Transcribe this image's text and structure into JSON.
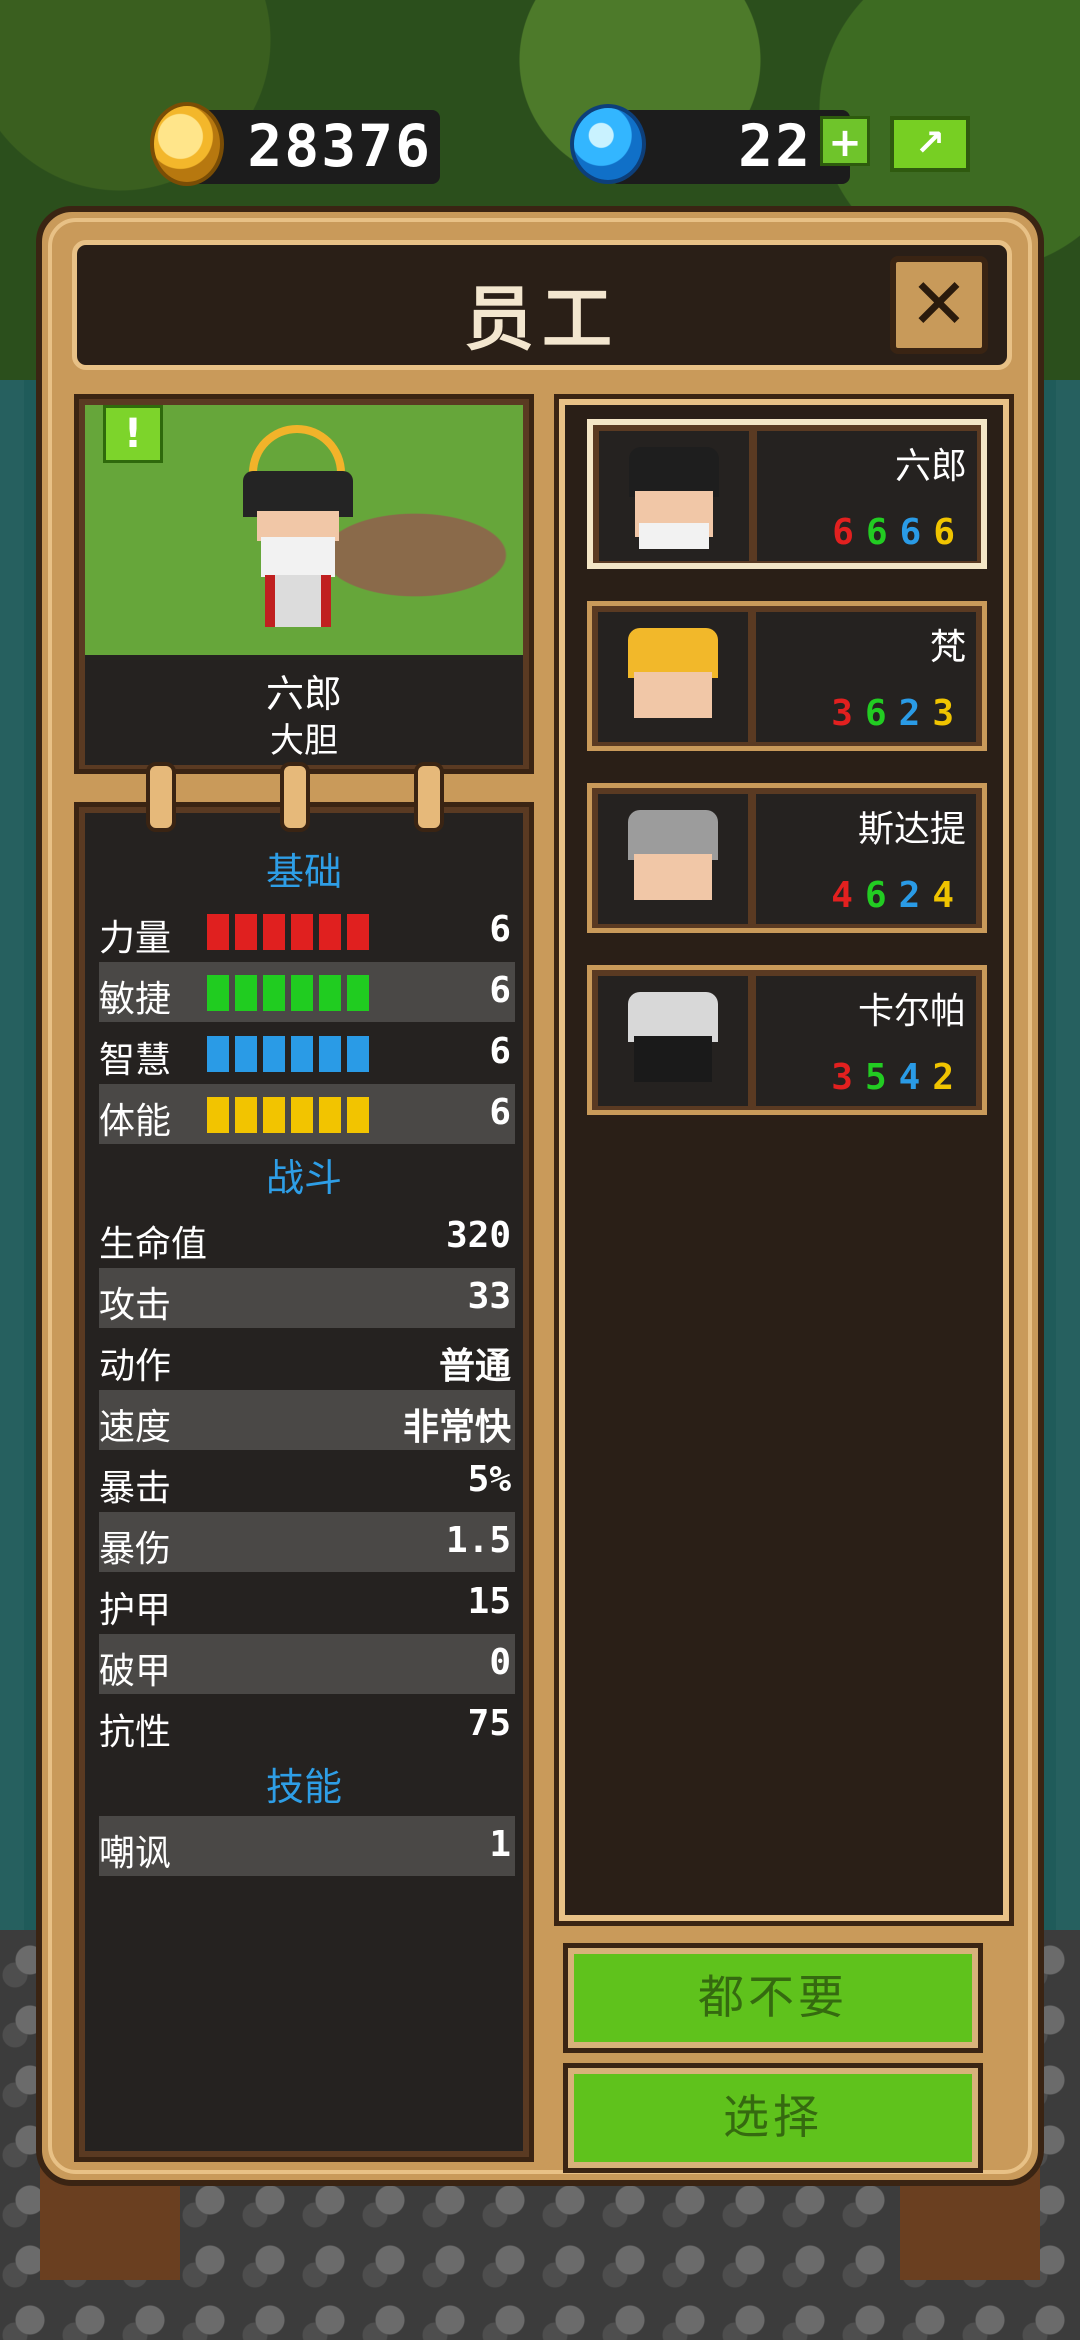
{
  "currency": {
    "gold": "28376",
    "gems": "22",
    "gem_add_label": "+",
    "share_label": "↗"
  },
  "panel": {
    "title": "员工",
    "close_label": "✕"
  },
  "selected_hero": {
    "name": "六郎",
    "trait": "大胆",
    "alert": "!"
  },
  "sections": {
    "basic": "基础",
    "combat": "战斗",
    "skills": "技能"
  },
  "basic_stats": [
    {
      "label": "力量",
      "value": "6",
      "bars": 6,
      "color": "#e0201f"
    },
    {
      "label": "敏捷",
      "value": "6",
      "bars": 6,
      "color": "#20cc20"
    },
    {
      "label": "智慧",
      "value": "6",
      "bars": 6,
      "color": "#2a9be6"
    },
    {
      "label": "体能",
      "value": "6",
      "bars": 6,
      "color": "#f2c400"
    }
  ],
  "combat_stats": [
    {
      "label": "生命值",
      "value": "320"
    },
    {
      "label": "攻击",
      "value": "33"
    },
    {
      "label": "动作",
      "value": "普通"
    },
    {
      "label": "速度",
      "value": "非常快"
    },
    {
      "label": "暴击",
      "value": "5%"
    },
    {
      "label": "暴伤",
      "value": "1.5"
    },
    {
      "label": "护甲",
      "value": "15"
    },
    {
      "label": "破甲",
      "value": "0"
    },
    {
      "label": "抗性",
      "value": "75"
    }
  ],
  "skills": [
    {
      "label": "嘲讽",
      "value": "1"
    }
  ],
  "roster": [
    {
      "name": "六郎",
      "str": "6",
      "dex": "6",
      "int": "6",
      "con": "6",
      "selected": true
    },
    {
      "name": "梵",
      "str": "3",
      "dex": "6",
      "int": "2",
      "con": "3",
      "selected": false
    },
    {
      "name": "斯达提",
      "str": "4",
      "dex": "6",
      "int": "2",
      "con": "4",
      "selected": false
    },
    {
      "name": "卡尔帕",
      "str": "3",
      "dex": "5",
      "int": "4",
      "con": "2",
      "selected": false
    }
  ],
  "buttons": {
    "decline": "都不要",
    "select": "选择"
  }
}
